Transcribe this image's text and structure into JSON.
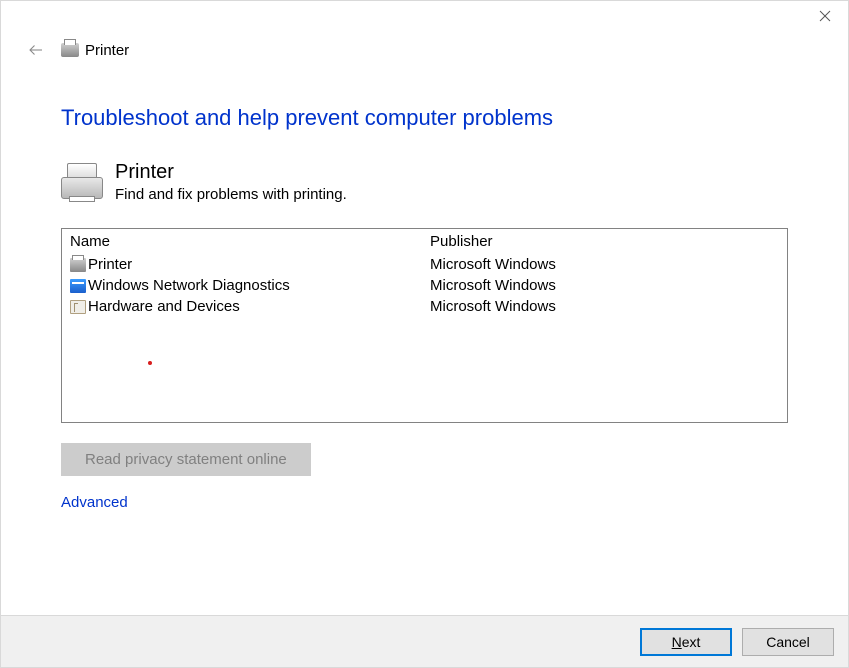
{
  "header": {
    "title": "Printer"
  },
  "main": {
    "heading": "Troubleshoot and help prevent computer problems",
    "section_title": "Printer",
    "section_desc": "Find and fix problems with printing."
  },
  "table": {
    "columns": {
      "name": "Name",
      "publisher": "Publisher"
    },
    "rows": [
      {
        "name": "Printer",
        "publisher": "Microsoft Windows",
        "icon": "printer"
      },
      {
        "name": "Windows Network Diagnostics",
        "publisher": "Microsoft Windows",
        "icon": "network"
      },
      {
        "name": "Hardware and Devices",
        "publisher": "Microsoft Windows",
        "icon": "hardware"
      }
    ]
  },
  "buttons": {
    "privacy": "Read privacy statement online",
    "advanced": "Advanced",
    "next_prefix": "N",
    "next_rest": "ext",
    "cancel": "Cancel"
  }
}
